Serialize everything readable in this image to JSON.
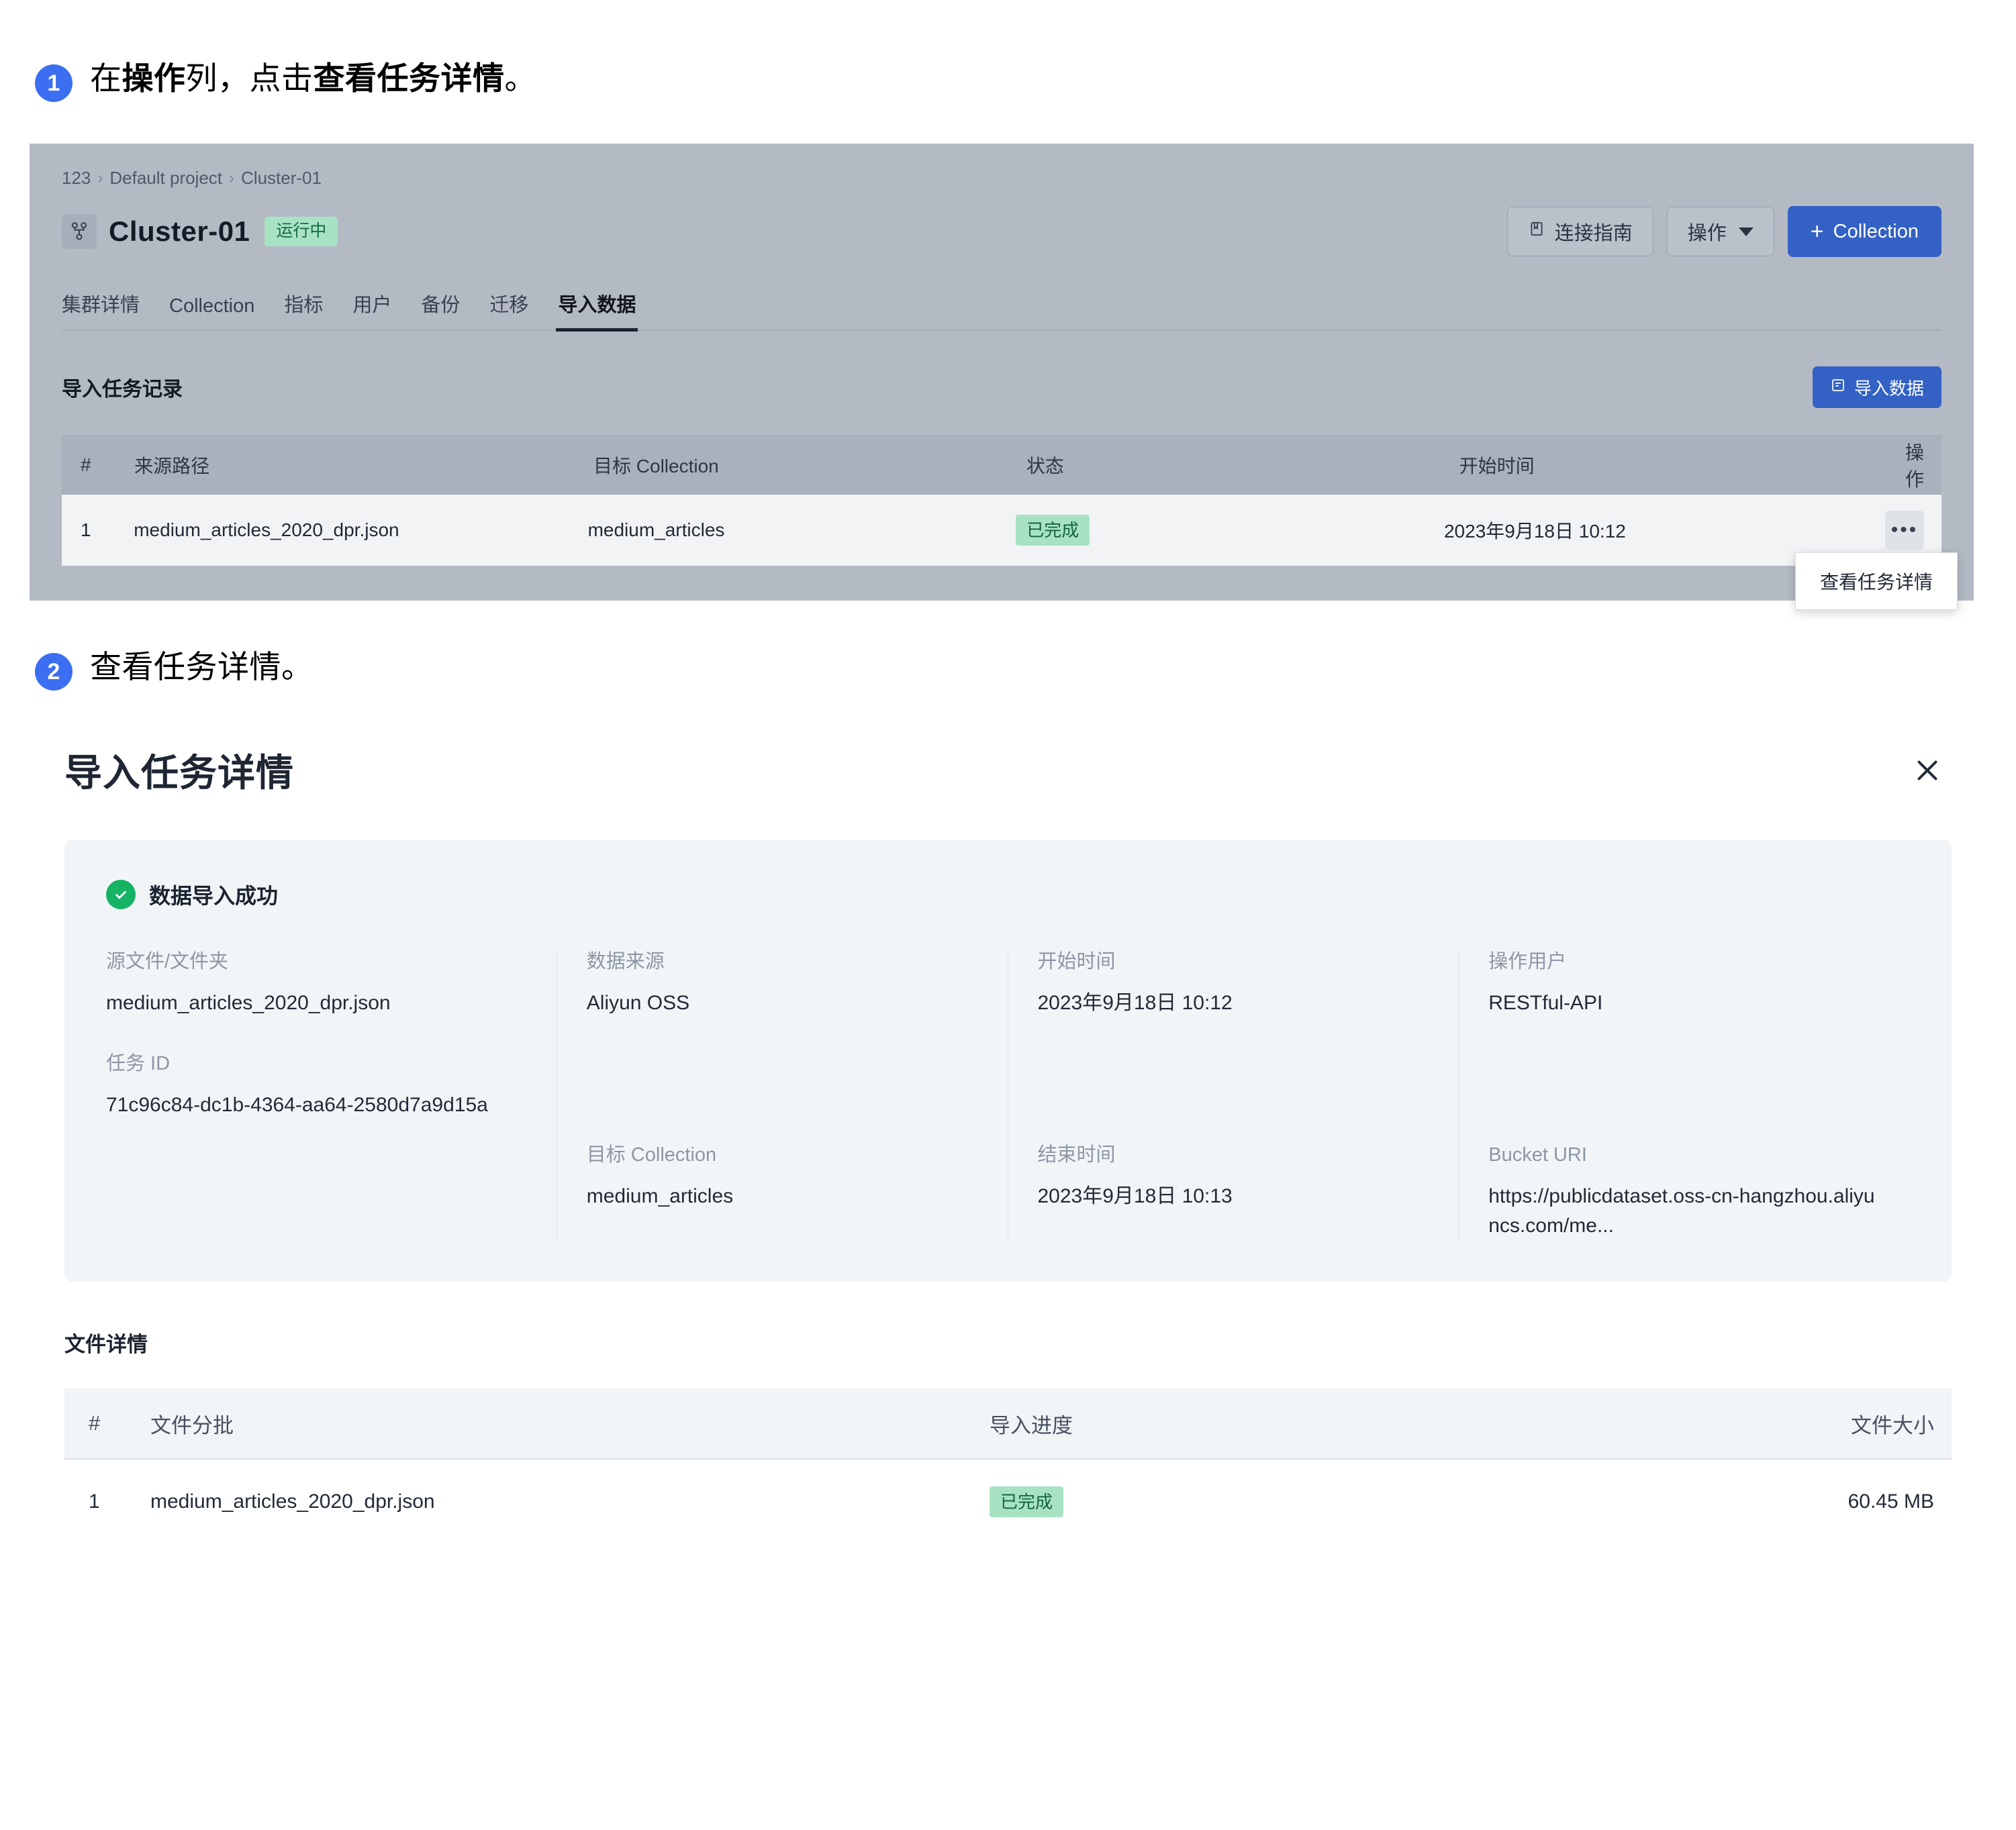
{
  "steps": [
    {
      "num": "1",
      "prefix": "在",
      "bold1": "操作",
      "mid": "列，点击",
      "bold2": "查看任务详情",
      "suffix": "。"
    },
    {
      "num": "2",
      "text": "查看任务详情。"
    }
  ],
  "console": {
    "breadcrumb": [
      "123",
      "Default project",
      "Cluster-01"
    ],
    "breadcrumb_separator": "›",
    "cluster_name": "Cluster-01",
    "cluster_status": "运行中",
    "cluster_icon": "cluster-node-icon",
    "header_buttons": {
      "connect_guide": "连接指南",
      "connect_guide_icon": "book-icon",
      "operations": "操作",
      "operations_chevron": "chevron-down-icon",
      "add_collection": "Collection",
      "add_collection_plus": "+"
    },
    "tabs": [
      {
        "label": "集群详情",
        "active": false
      },
      {
        "label": "Collection",
        "active": false
      },
      {
        "label": "指标",
        "active": false
      },
      {
        "label": "用户",
        "active": false
      },
      {
        "label": "备份",
        "active": false
      },
      {
        "label": "迁移",
        "active": false
      },
      {
        "label": "导入数据",
        "active": true
      }
    ],
    "table_title": "导入任务记录",
    "import_button": "导入数据",
    "import_button_icon": "import-icon",
    "columns": [
      "#",
      "来源路径",
      "目标 Collection",
      "状态",
      "开始时间",
      "操作"
    ],
    "rows": [
      {
        "index": "1",
        "source_path": "medium_articles_2020_dpr.json",
        "target_collection": "medium_articles",
        "status": "已完成",
        "start_time": "2023年9月18日 10:12",
        "action_icon": "more-options-icon"
      }
    ],
    "context_menu": {
      "item": "查看任务详情"
    }
  },
  "detail": {
    "title": "导入任务详情",
    "close_icon": "close-icon",
    "success_icon": "check-circle-icon",
    "success_text": "数据导入成功",
    "fields": {
      "source_file_label": "源文件/文件夹",
      "source_file_value": "medium_articles_2020_dpr.json",
      "task_id_label": "任务 ID",
      "task_id_value": "71c96c84-dc1b-4364-aa64-2580d7a9d15a",
      "data_source_label": "数据来源",
      "data_source_value": "Aliyun OSS",
      "target_collection_label": "目标 Collection",
      "target_collection_value": "medium_articles",
      "start_time_label": "开始时间",
      "start_time_value": "2023年9月18日 10:12",
      "end_time_label": "结束时间",
      "end_time_value": "2023年9月18日 10:13",
      "operator_label": "操作用户",
      "operator_value": "RESTful-API",
      "bucket_uri_label": "Bucket URI",
      "bucket_uri_value": "https://publicdataset.oss-cn-hangzhou.aliyuncs.com/me..."
    },
    "file_section_title": "文件详情",
    "file_columns": [
      "#",
      "文件分批",
      "导入进度",
      "文件大小"
    ],
    "file_rows": [
      {
        "index": "1",
        "batch": "medium_articles_2020_dpr.json",
        "progress": "已完成",
        "size": "60.45 MB"
      }
    ]
  },
  "colors": {
    "accent_blue": "#3361c4",
    "badge_blue": "#3b6ef0",
    "success_green": "#16b364",
    "status_bg": "#a7e3c3",
    "status_fg": "#14633e",
    "console_bg": "#b4bac4",
    "card_bg": "#f2f5f8"
  }
}
